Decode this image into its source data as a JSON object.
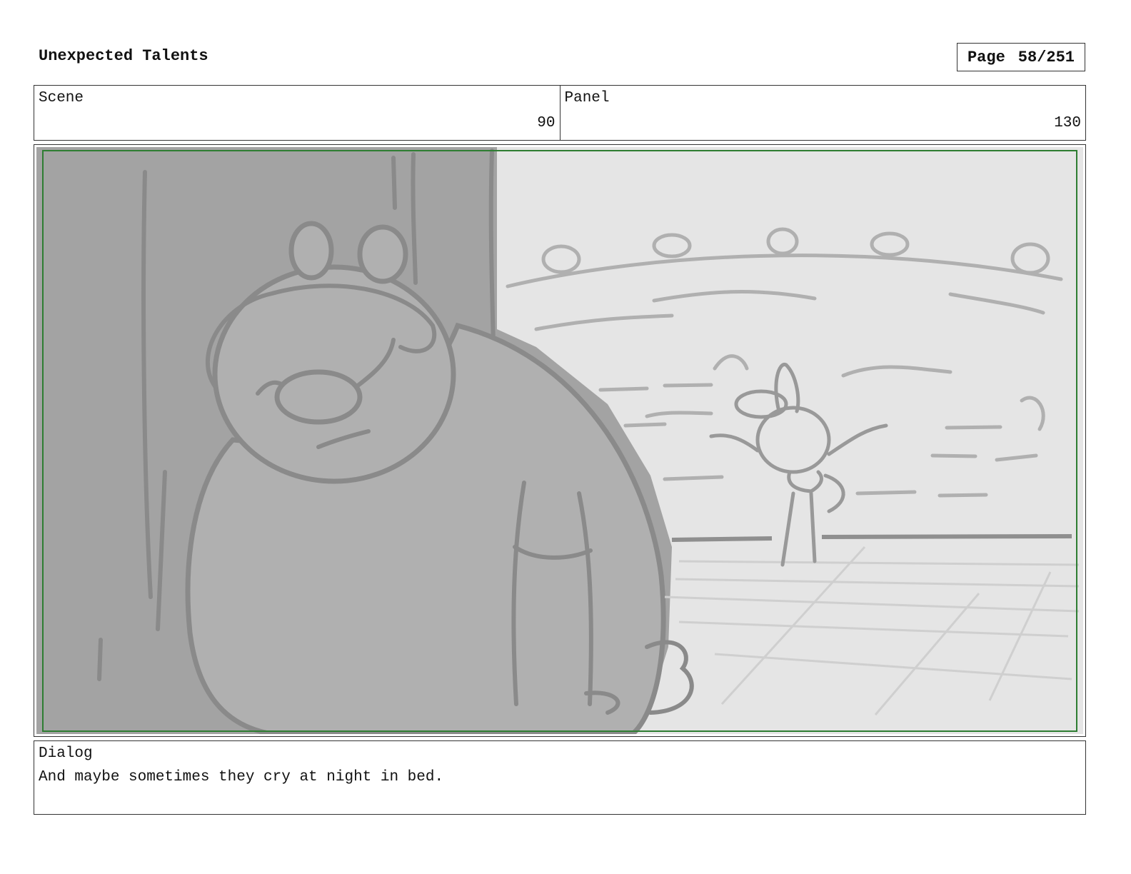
{
  "header": {
    "title": "Unexpected Talents",
    "page_label": "Page",
    "page_value": "58/251"
  },
  "scene": {
    "label": "Scene",
    "value": "90"
  },
  "panel": {
    "label": "Panel",
    "value": "130"
  },
  "dialog": {
    "label": "Dialog",
    "text": "And maybe sometimes they cry at night in bed."
  },
  "colors": {
    "frame_guide": "#2e7d32",
    "background_fill": "#e5e5e5",
    "foreground_shadow": "#a3a3a3",
    "bear_fill": "#b0b0b0",
    "sketch_line": "#8a8a8a"
  }
}
